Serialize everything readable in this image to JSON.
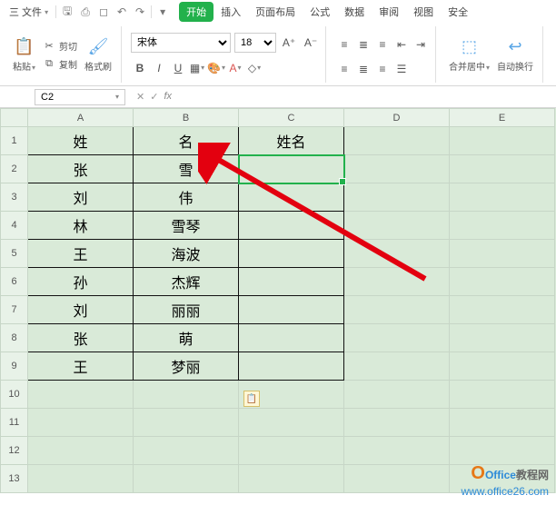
{
  "menubar": {
    "file": "三 文件",
    "qat_icons": [
      "save-icon",
      "print-icon",
      "preview-icon",
      "undo-icon",
      "redo-icon"
    ],
    "tabs": {
      "start": "开始",
      "insert": "插入",
      "layout": "页面布局",
      "formula": "公式",
      "data": "数据",
      "review": "审阅",
      "view": "视图",
      "security": "安全"
    }
  },
  "ribbon": {
    "paste": "粘贴",
    "cut": "剪切",
    "copy": "复制",
    "format_painter": "格式刷",
    "font_name": "宋体",
    "font_size": "18",
    "merge_center": "合并居中",
    "wrap": "自动换行"
  },
  "namebox": "C2",
  "fx_label": "fx",
  "columns": [
    "A",
    "B",
    "C",
    "D",
    "E"
  ],
  "row_count": 13,
  "table": {
    "header": {
      "a": "姓",
      "b": "名",
      "c": "姓名"
    },
    "rows": [
      {
        "a": "张",
        "b": "雪"
      },
      {
        "a": "刘",
        "b": "伟"
      },
      {
        "a": "林",
        "b": "雪琴"
      },
      {
        "a": "王",
        "b": "海波"
      },
      {
        "a": "孙",
        "b": "杰辉"
      },
      {
        "a": "刘",
        "b": "丽丽"
      },
      {
        "a": "张",
        "b": "萌"
      },
      {
        "a": "王",
        "b": "梦丽"
      }
    ]
  },
  "watermark": {
    "brand1": "Office",
    "brand2": "教程网",
    "url": "www.office26.com"
  }
}
